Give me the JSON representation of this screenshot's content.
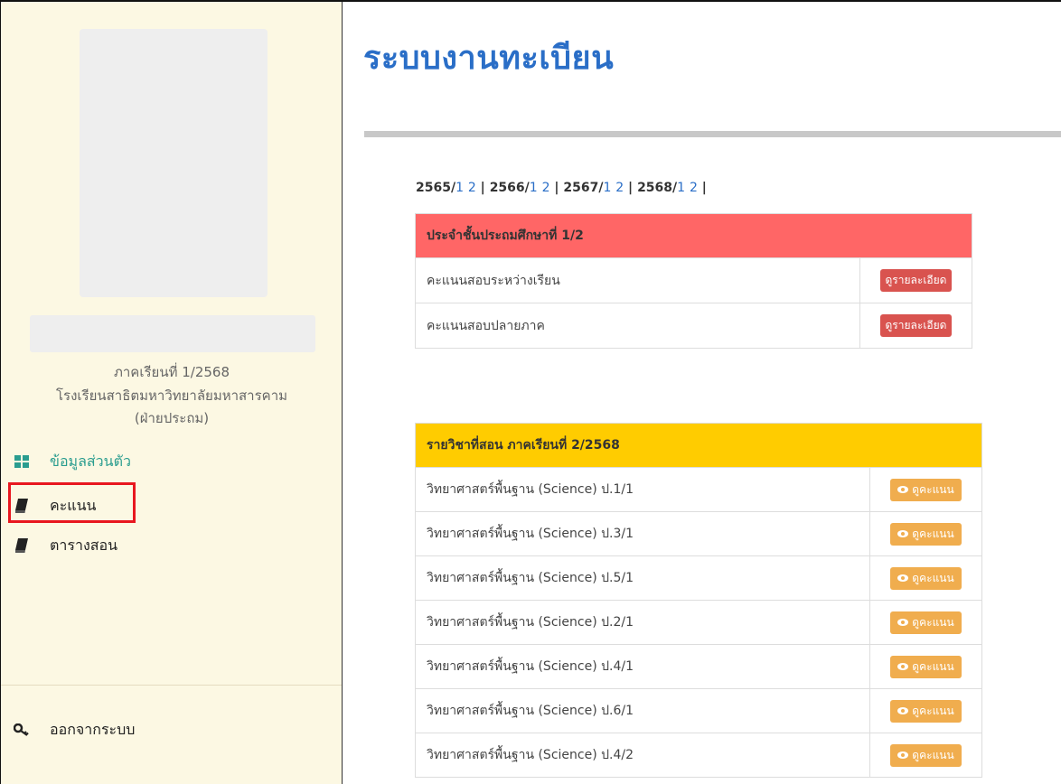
{
  "sidebar": {
    "semester": "ภาคเรียนที่ 1/2568",
    "school_line1": "โรงเรียนสาธิตมหาวิทยาลัยมหาสารคาม",
    "school_line2": "(ฝ่ายประถม)",
    "menu": [
      {
        "label": "ข้อมูลส่วนตัว",
        "icon": "grid-icon"
      },
      {
        "label": "คะแนน",
        "icon": "book-icon"
      },
      {
        "label": "ตารางสอน",
        "icon": "book-icon"
      }
    ],
    "logout": {
      "label": "ออกจากระบบ",
      "icon": "key-icon"
    }
  },
  "main": {
    "title": "ระบบงานทะเบียน",
    "terms": [
      {
        "year": "2565",
        "sems": [
          "1",
          "2"
        ]
      },
      {
        "year": "2566",
        "sems": [
          "1",
          "2"
        ]
      },
      {
        "year": "2567",
        "sems": [
          "1",
          "2"
        ]
      },
      {
        "year": "2568",
        "sems": [
          "1",
          "2"
        ]
      }
    ],
    "class_table": {
      "header": "ประจำชั้นประถมศึกษาที่ 1/2",
      "header_color": "#ff6666",
      "rows": [
        {
          "label": "คะแนนสอบระหว่างเรียน",
          "button": "ดูรายละเอียด"
        },
        {
          "label": "คะแนนสอบปลายภาค",
          "button": "ดูรายละเอียด"
        }
      ]
    },
    "subject_table": {
      "header": "รายวิชาที่สอน ภาคเรียนที่ 2/2568",
      "header_color": "#ffcc00",
      "button": "ดูคะแนน",
      "rows": [
        "วิทยาศาสตร์พื้นฐาน (Science) ป.1/1",
        "วิทยาศาสตร์พื้นฐาน (Science) ป.3/1",
        "วิทยาศาสตร์พื้นฐาน (Science) ป.5/1",
        "วิทยาศาสตร์พื้นฐาน (Science) ป.2/1",
        "วิทยาศาสตร์พื้นฐาน (Science) ป.4/1",
        "วิทยาศาสตร์พื้นฐาน (Science) ป.6/1",
        "วิทยาศาสตร์พื้นฐาน (Science) ป.4/2"
      ]
    }
  }
}
